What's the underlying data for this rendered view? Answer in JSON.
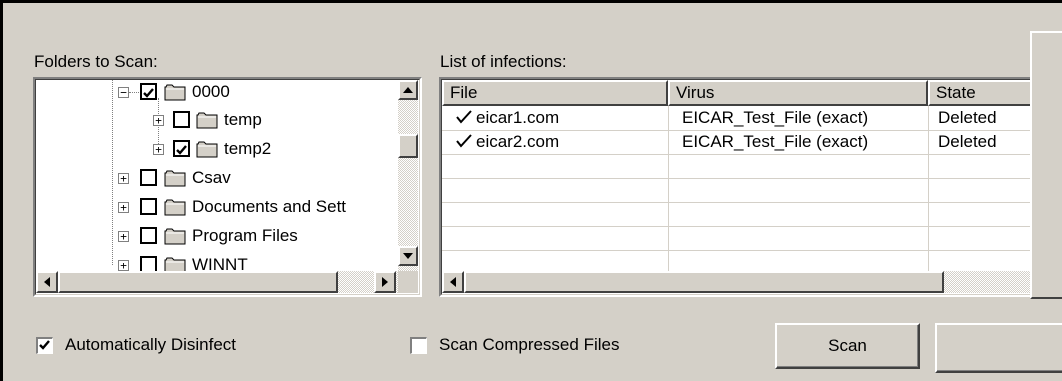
{
  "folders": {
    "label": "Folders to Scan:",
    "items": [
      {
        "label": "0000",
        "checked": true
      },
      {
        "label": "temp",
        "checked": false
      },
      {
        "label": "temp2",
        "checked": true
      },
      {
        "label": "Csav",
        "checked": false
      },
      {
        "label": "Documents and Sett",
        "checked": false
      },
      {
        "label": "Program Files",
        "checked": false
      },
      {
        "label": "WINNT",
        "checked": false
      }
    ]
  },
  "infections": {
    "label": "List of infections:",
    "columns": [
      "File",
      "Virus",
      "State"
    ],
    "rows": [
      {
        "file": "eicar1.com",
        "virus": "EICAR_Test_File (exact)",
        "state": "Deleted"
      },
      {
        "file": "eicar2.com",
        "virus": "EICAR_Test_File (exact)",
        "state": "Deleted"
      }
    ]
  },
  "options": {
    "auto_disinfect": {
      "label": "Automatically Disinfect",
      "checked": true
    },
    "scan_compressed": {
      "label": "Scan Compressed Files",
      "checked": false
    }
  },
  "buttons": {
    "scan": "Scan"
  },
  "icons": {
    "expand": "plus-box-icon",
    "collapse": "minus-box-icon",
    "folder": "folder-icon",
    "check": "checkmark-icon"
  }
}
